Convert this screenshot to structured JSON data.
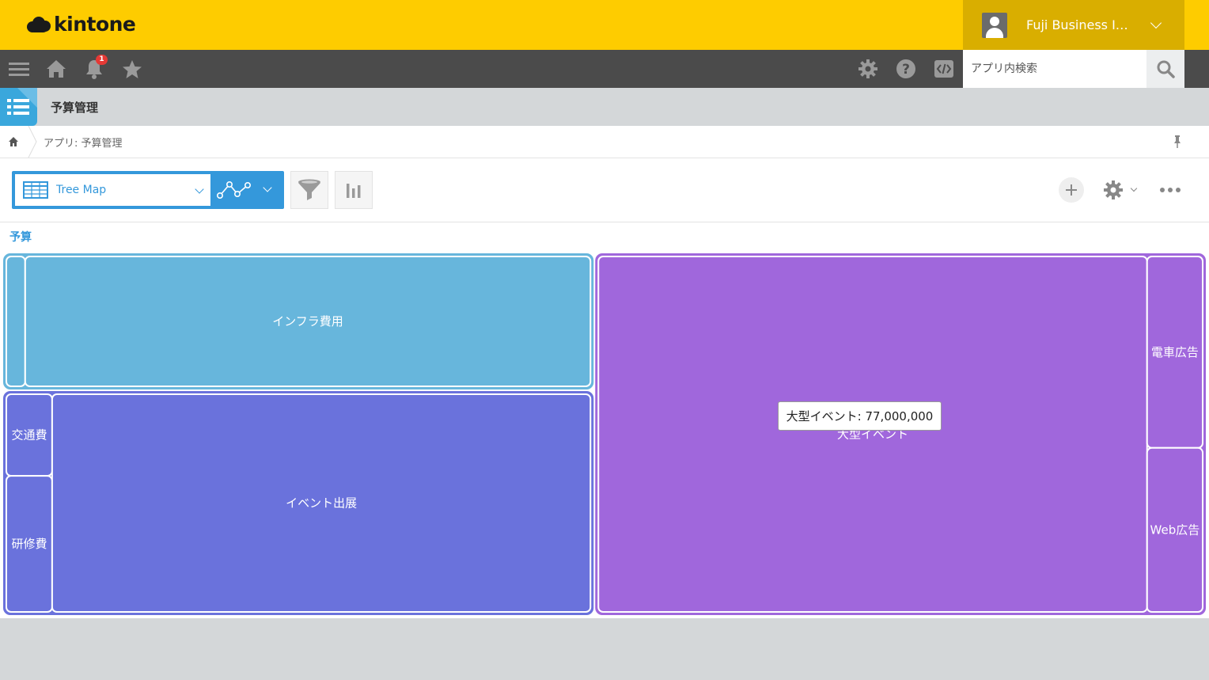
{
  "header": {
    "brand": "kintone",
    "user_name": "Fuji Business I…",
    "colors": {
      "header_bg": "#fecc00",
      "user_bg": "#d9ae00",
      "nav_bg": "#4b4b4b"
    }
  },
  "nav": {
    "notification_count": "1",
    "icons": [
      "menu-icon",
      "home-icon",
      "bell-icon",
      "star-icon",
      "gear-icon",
      "help-icon",
      "code-icon"
    ],
    "search": {
      "placeholder": "アプリ内検索"
    }
  },
  "app": {
    "title": "予算管理",
    "breadcrumb": "アプリ: 予算管理"
  },
  "toolbar": {
    "view_name": "Tree Map"
  },
  "chart_data": {
    "type": "treemap",
    "title": "予算",
    "tooltip": "大型イベント: 77,000,000",
    "groups": [
      {
        "color": "#67b6dc",
        "children": [
          {
            "label": "",
            "value": 1000000
          },
          {
            "label": "インフラ費用",
            "value": 30000000
          }
        ]
      },
      {
        "color": "#6a72dc",
        "children": [
          {
            "label": "交通費",
            "value": 1500000
          },
          {
            "label": "研修費",
            "value": 2500000
          },
          {
            "label": "イベント出展",
            "value": 47000000
          }
        ]
      },
      {
        "color": "#a067dc",
        "children": [
          {
            "label": "大型イベント",
            "value": 77000000
          },
          {
            "label": "電車広告",
            "value": 4200000
          },
          {
            "label": "Web広告",
            "value": 3600000
          }
        ]
      }
    ]
  }
}
